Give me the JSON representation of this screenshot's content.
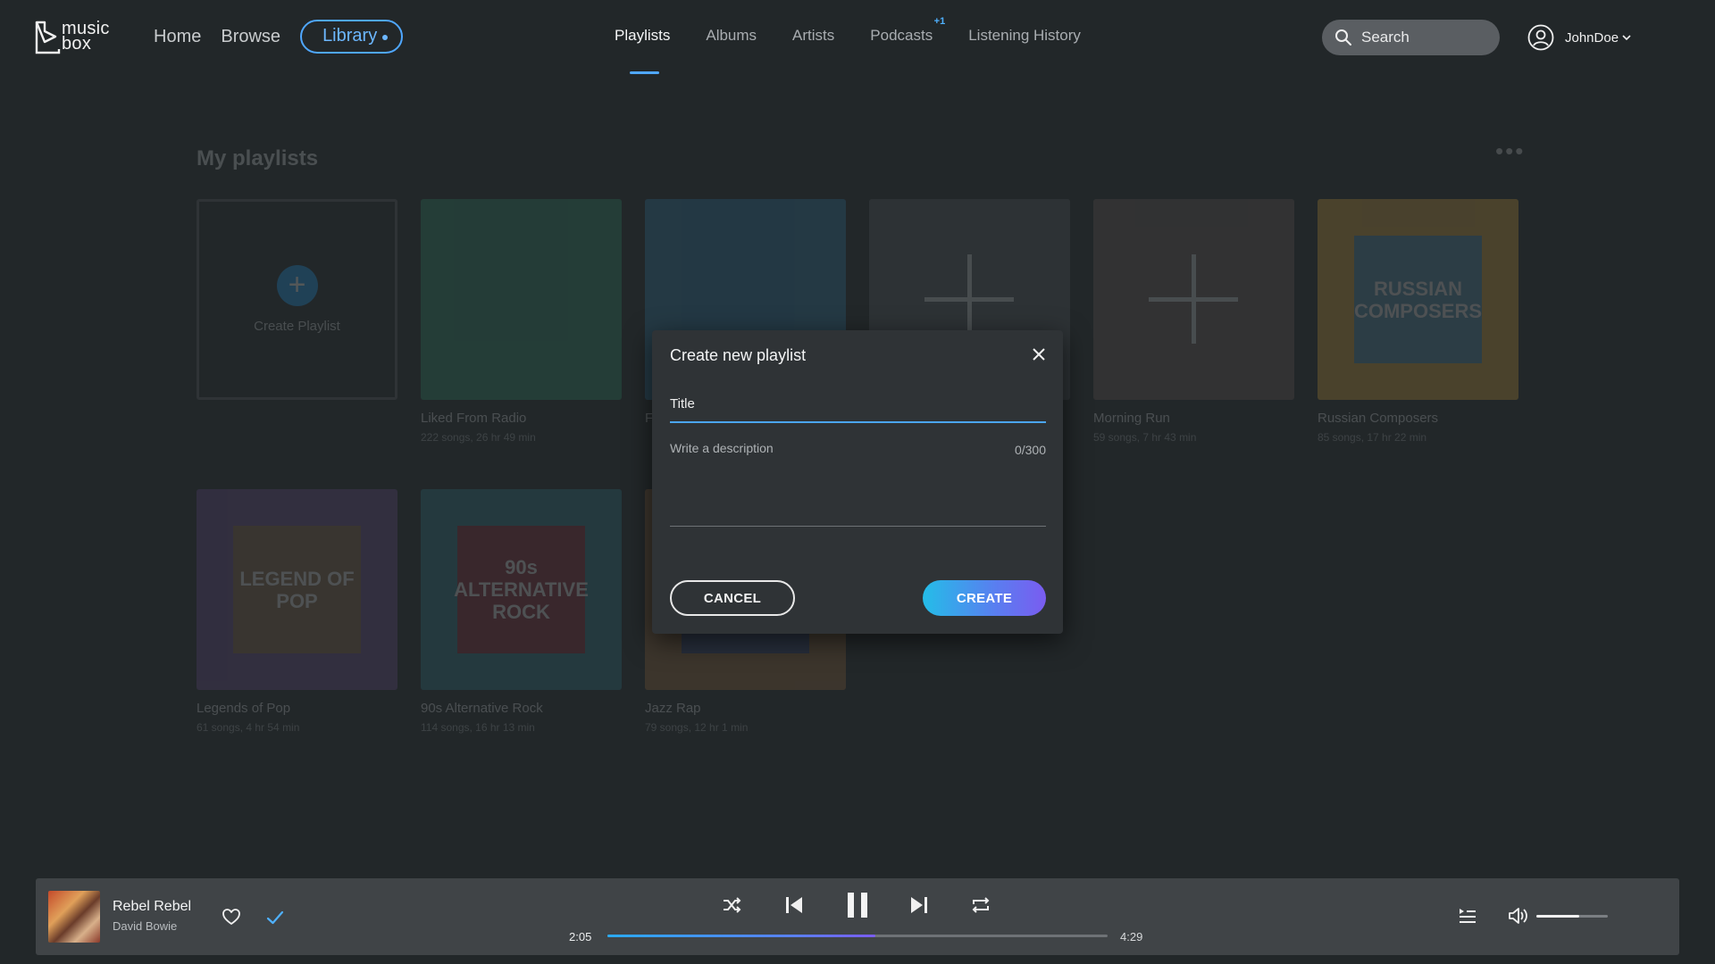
{
  "brand": {
    "line1": "music",
    "line2": "box"
  },
  "mainnav": {
    "home": "Home",
    "browse": "Browse",
    "library": "Library"
  },
  "subnav": {
    "tabs": [
      "Playlists",
      "Albums",
      "Artists",
      "Podcasts",
      "Listening History"
    ],
    "active": "Playlists",
    "podcasts_badge": "+1"
  },
  "search": {
    "label": "Search"
  },
  "user": {
    "name": "JohnDoe"
  },
  "library": {
    "section_title": "My playlists",
    "more_label": "•••",
    "create_label": "Create Playlist",
    "playlists": [
      {
        "name": "Liked From Radio",
        "meta": "222 songs, 26 hr 49 min",
        "cover_text": "",
        "color": "#2f8a6a"
      },
      {
        "name": "Fa",
        "meta": "",
        "cover_text": "",
        "color": "#2b78a6"
      },
      {
        "name": "",
        "meta": "",
        "cover_text": "",
        "color": "#565b60"
      },
      {
        "name": "Morning Run",
        "meta": "59 songs, 7 hr 43 min",
        "cover_text": "",
        "color": "#6a5a58"
      },
      {
        "name": "Russian Composers",
        "meta": "85 songs, 17 hr 22 min",
        "cover_text": "RUSSIAN COMPOSERS",
        "color": "#d6a13a"
      },
      {
        "name": "Legends of Pop",
        "meta": "61 songs, 4 hr 54 min",
        "cover_text": "LEGEND OF POP",
        "color": "#6a4b8c"
      },
      {
        "name": "90s Alternative Rock",
        "meta": "114 songs, 16 hr 13 min",
        "cover_text": "90s ALTERNATIVE ROCK",
        "color": "#2f7a8a"
      },
      {
        "name": "Jazz Rap",
        "meta": "79 songs, 12 hr 1 min",
        "cover_text": "",
        "color": "#9a6a3a"
      }
    ]
  },
  "modal": {
    "title": "Create new playlist",
    "title_placeholder": "Title",
    "description_placeholder": "Write a description",
    "description_count": "0/300",
    "cancel_label": "CANCEL",
    "create_label": "CREATE"
  },
  "player": {
    "track_title": "Rebel Rebel",
    "track_artist": "David Bowie",
    "elapsed": "2:05",
    "duration": "4:29",
    "progress_fraction": 0.535,
    "volume_fraction": 0.6
  },
  "icons": {
    "logo": "musicbox-logo-icon",
    "search": "search-icon",
    "avatar": "user-avatar-icon",
    "chevron": "chevron-down-icon",
    "close": "close-icon",
    "heart": "heart-icon",
    "check": "check-icon",
    "shuffle": "shuffle-icon",
    "prev": "skip-previous-icon",
    "pause": "pause-icon",
    "next": "skip-next-icon",
    "repeat": "repeat-icon",
    "queue": "queue-icon",
    "volume": "volume-icon"
  },
  "colors": {
    "accent": "#4fa7ff",
    "background": "#222729",
    "modal": "#2f3336",
    "player": "#404447"
  }
}
